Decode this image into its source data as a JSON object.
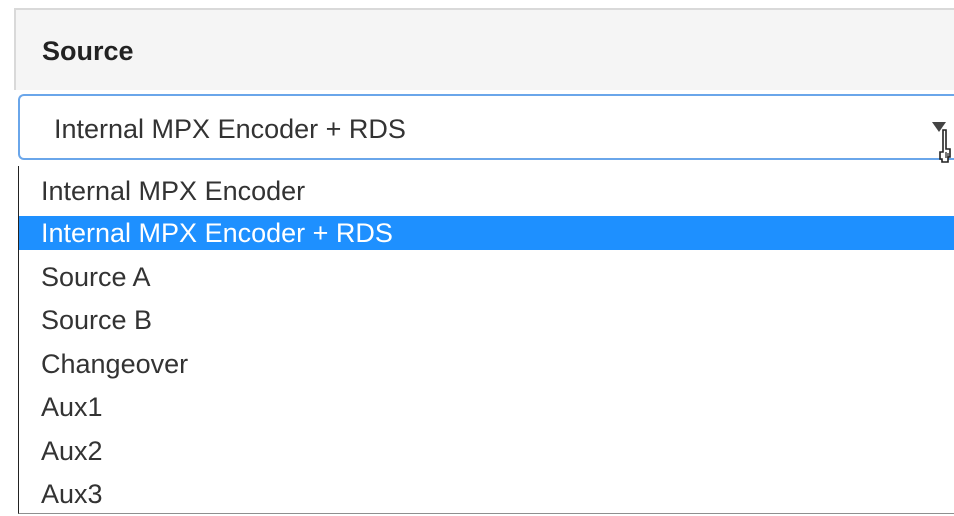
{
  "panel": {
    "title": "Source"
  },
  "select": {
    "value": "Internal MPX Encoder + RDS",
    "options": [
      "Internal MPX Encoder",
      "Internal MPX Encoder + RDS",
      "Source A",
      "Source B",
      "Changeover",
      "Aux1",
      "Aux2",
      "Aux3"
    ],
    "selected_option_index": 1,
    "selected_color": "#1e90ff",
    "caret_icon": "triangle-down-icon",
    "pointer_icon": "hand-pointer-icon"
  }
}
